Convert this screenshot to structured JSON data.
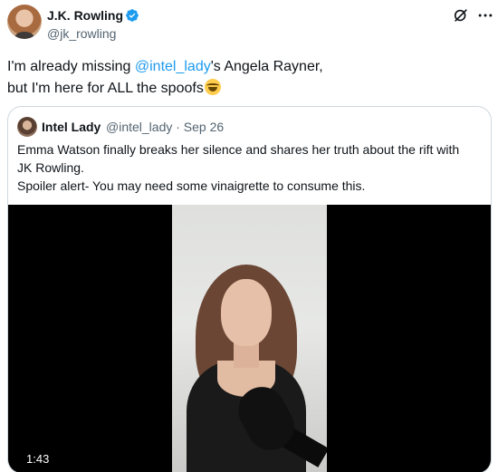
{
  "author": {
    "name": "J.K. Rowling",
    "handle": "@jk_rowling"
  },
  "tweet": {
    "text_before": "I'm already missing ",
    "mention": "@intel_lady",
    "text_after": "'s Angela Rayner,",
    "line2": "but I'm here for ALL the spoofs",
    "emoji": "rolling-on-floor-laughing-emoji"
  },
  "quote": {
    "name": "Intel Lady",
    "handle_date": "@intel_lady · Sep 26",
    "line1": "Emma Watson finally breaks her silence and shares her truth about the rift with",
    "line2": "JK Rowling.",
    "line3": "Spoiler alert- You may need some vinaigrette to consume this."
  },
  "video": {
    "duration": "1:43"
  },
  "colors": {
    "accent": "#1d9bf0",
    "verified": "#1d9bf0",
    "text_primary": "#0f1419",
    "text_secondary": "#536471",
    "border": "#cfd9de"
  }
}
